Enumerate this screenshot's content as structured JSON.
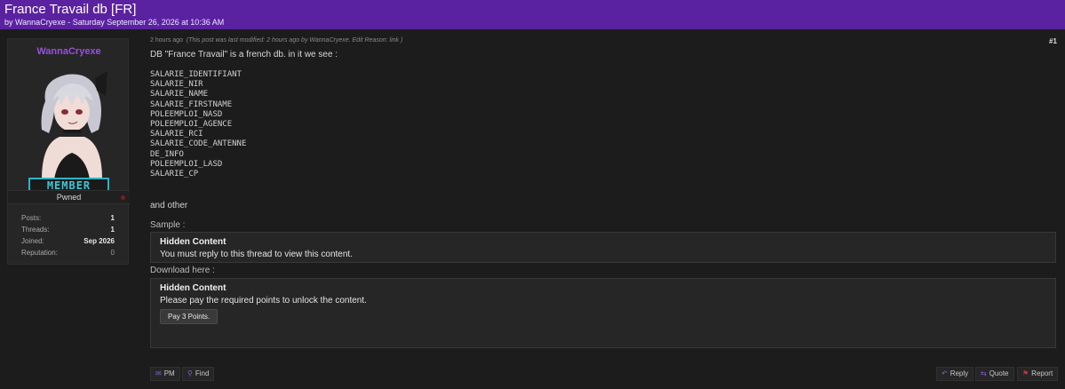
{
  "thread": {
    "title": "France Travail db [FR]",
    "byline": "by WannaCryexe - Saturday September 26, 2026 at 10:36 AM"
  },
  "author": {
    "username": "WannaCryexe",
    "status": "Pwned",
    "rank": "MEMBER",
    "stats": [
      {
        "label": "Posts:",
        "value": "1"
      },
      {
        "label": "Threads:",
        "value": "1"
      },
      {
        "label": "Joined:",
        "value": "Sep 2026"
      },
      {
        "label": "Reputation:",
        "value": "0"
      }
    ]
  },
  "post": {
    "time": "2 hours ago",
    "modified_note": "(This post was last modified: 2 hours ago by WannaCryexe. Edit Reason: link )",
    "number": "#1",
    "intro": "DB \"France Travail\" is a french db. in it we see :",
    "fields": [
      "SALARIE_IDENTIFIANT",
      "SALARIE_NIR",
      "SALARIE_NAME",
      "SALARIE_FIRSTNAME",
      "POLEEMPLOI_NASD",
      "POLEEMPLOI_AGENCE",
      "SALARIE_RCI",
      "SALARIE_CODE_ANTENNE",
      "DE_INFO",
      "POLEEMPLOI_LASD",
      "SALARIE_CP"
    ],
    "and_other": "and other",
    "sample_label": "Sample :",
    "download_label": "Download here :",
    "hidden_sample": {
      "title": "Hidden Content",
      "message": "You must reply to this thread to view this content."
    },
    "hidden_download": {
      "title": "Hidden Content",
      "message": "Please pay the required points to unlock the content.",
      "button": "Pay 3 Points."
    }
  },
  "actions": {
    "pm": "PM",
    "find": "Find",
    "reply": "Reply",
    "quote": "Quote",
    "report": "Report"
  },
  "colors": {
    "header": "#5a22a0",
    "username": "#9a4fe0",
    "rank": "#2ab5c8",
    "background": "#1c1c1c"
  }
}
